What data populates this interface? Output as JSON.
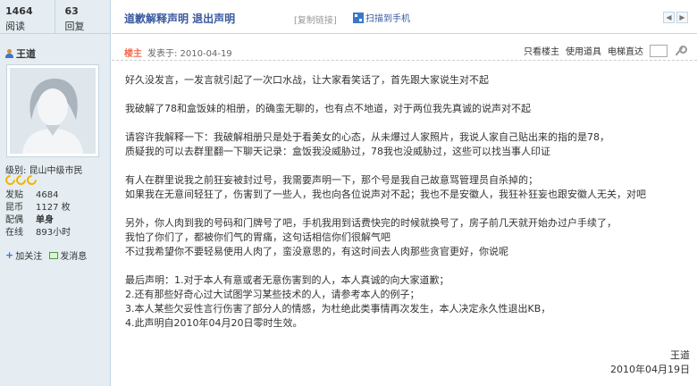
{
  "sidebar": {
    "stats": [
      {
        "value": "1464",
        "label": "阅读"
      },
      {
        "value": "63",
        "label": "回复"
      }
    ],
    "username": "王道",
    "rank_prefix": "级别:",
    "rank_name": "昆山中级市民",
    "profile": [
      {
        "key": "发贴",
        "value": "4684",
        "bold": false
      },
      {
        "key": "昆币",
        "value": "1127 枚",
        "bold": false
      },
      {
        "key": "配偶",
        "value": "单身",
        "bold": true
      },
      {
        "key": "在线",
        "value": "893小时",
        "bold": false
      }
    ],
    "follow_label": "加关注",
    "message_label": "发消息"
  },
  "header": {
    "title": "道歉解释声明 退出声明",
    "copy_link": "[复制链接]",
    "qr_label": "扫描到手机",
    "prev_icon": "arrow-left-icon",
    "next_icon": "arrow-right-icon"
  },
  "post": {
    "op_badge": "楼主",
    "posted": "发表于: 2010-04-19",
    "tools": {
      "only_op": "只看楼主",
      "use_item": "使用道具",
      "jump": "电梯直达"
    },
    "paragraphs": [
      [
        "好久没发言，一发言就引起了一次口水战，让大家看笑话了，首先跟大家说生对不起"
      ],
      [
        "我破解了78和盒饭妹的相册，的确蛮无聊的，也有点不地道，对于两位我先真诚的说声对不起"
      ],
      [
        "请容许我解释一下：我破解相册只是处于看美女的心态，从未爆过人家照片，我说人家自己贴出来的指的是78，",
        "质疑我的可以去群里翻一下聊天记录：盒饭我没威胁过，78我也没威胁过，这些可以找当事人印证"
      ],
      [
        "有人在群里说我之前狂妄被封过号，我需要声明一下，那个号是我自己故意骂管理员自杀掉的；",
        "如果我在无意间轻狂了，伤害到了一些人，我也向各位说声对不起；我也不是安徽人，我狂补狂妄也跟安徽人无关，对吧"
      ],
      [
        "另外，你人肉到我的号码和门牌号了吧，手机我用到话费快完的时候就换号了，房子前几天就开始办过户手续了，",
        "我怕了你们了，都被你们气的胃痛，这句话相信你们很解气吧",
        "不过我希望你不要轻易使用人肉了，蛮没意思的，有这时间去人肉那些贪官更好，你说呢"
      ],
      [
        "最后声明：1.对于本人有意或者无意伤害到的人，本人真诚的向大家道歉；",
        "2.还有那些好奇心过大试图学习某些技术的人，请参考本人的例子；",
        "3.本人某些欠妥性言行伤害了部分人的情感，为杜绝此类事情再次发生，本人决定永久性退出KB，",
        "4.此声明自2010年04月20日零时生效。"
      ]
    ],
    "signature_name": "王道",
    "signature_date": "2010年04月19日"
  },
  "colors": {
    "sidebar_bg": "#e5edf2",
    "border": "#c2d5e3",
    "title_blue": "#3a59a0",
    "op_orange": "#f26c4f",
    "star_gold": "#f0b400"
  }
}
